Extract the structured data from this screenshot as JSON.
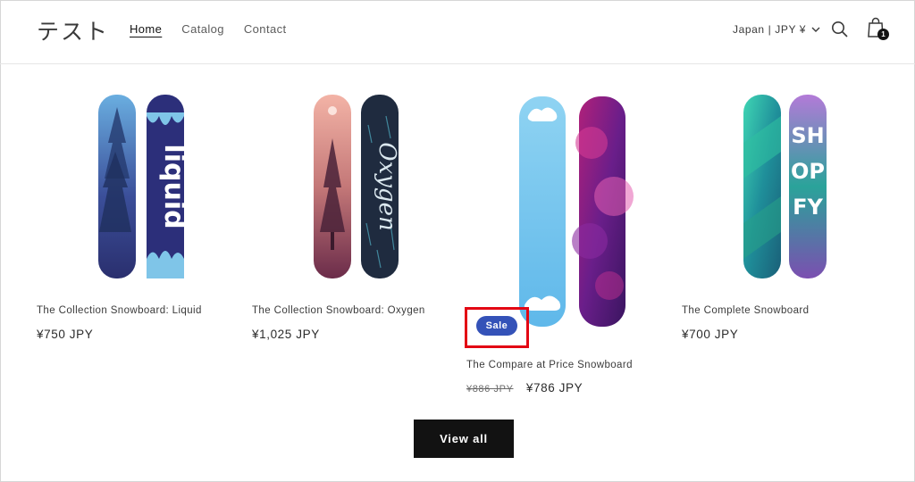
{
  "header": {
    "logo": "テスト",
    "nav": [
      {
        "label": "Home",
        "active": true
      },
      {
        "label": "Catalog",
        "active": false
      },
      {
        "label": "Contact",
        "active": false
      }
    ],
    "locale": "Japan | JPY ¥",
    "cart_count": "1",
    "icons": [
      "search-icon",
      "cart-icon",
      "chevron-down-icon"
    ]
  },
  "products": [
    {
      "title": "The Collection Snowboard: Liquid",
      "price": "¥750 JPY",
      "compare_price": "",
      "badge": ""
    },
    {
      "title": "The Collection Snowboard: Oxygen",
      "price": "¥1,025 JPY",
      "compare_price": "",
      "badge": ""
    },
    {
      "title": "The Compare at Price Snowboard",
      "price": "¥786 JPY",
      "compare_price": "¥886 JPY",
      "badge": "Sale"
    },
    {
      "title": "The Complete Snowboard",
      "price": "¥700 JPY",
      "compare_price": "",
      "badge": ""
    }
  ],
  "board_art": {
    "liquid": "liquid",
    "oxygen": "Oxygen",
    "complete": [
      "SH",
      "OP",
      "FY"
    ]
  },
  "view_all_label": "View all",
  "colors": {
    "sale_badge": "#3452b8",
    "highlight": "#e30613",
    "button": "#121212"
  }
}
